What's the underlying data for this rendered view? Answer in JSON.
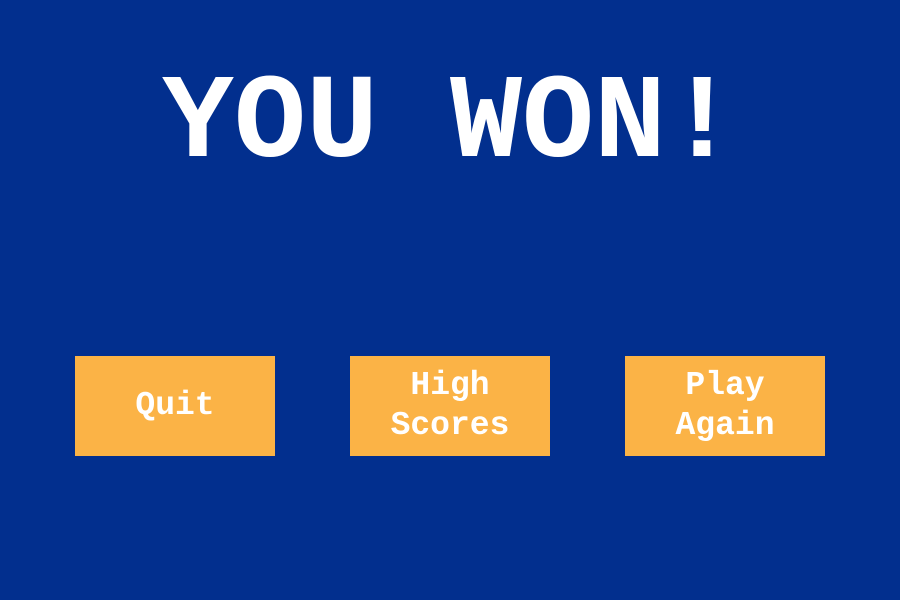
{
  "screen": {
    "title": "YOU WON!",
    "background_color": "#022f8e",
    "button_color": "#fbb346",
    "text_color": "#ffffff"
  },
  "buttons": {
    "quit_label": "Quit",
    "high_scores_label": "High\nScores",
    "play_again_label": "Play\nAgain"
  }
}
